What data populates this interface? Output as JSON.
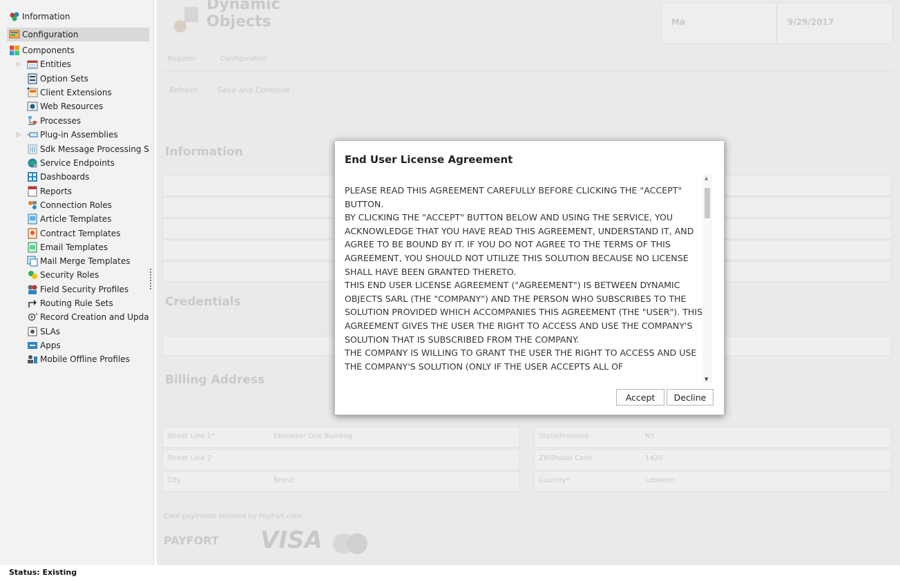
{
  "sidebar": {
    "top": [
      {
        "label": "Information",
        "icon": "information-icon"
      },
      {
        "label": "Configuration",
        "icon": "configuration-icon"
      },
      {
        "label": "Components",
        "icon": "components-icon"
      }
    ],
    "components": [
      {
        "label": "Entities",
        "icon": "entities-icon",
        "expandable": true
      },
      {
        "label": "Option Sets",
        "icon": "option-sets-icon"
      },
      {
        "label": "Client Extensions",
        "icon": "client-extensions-icon"
      },
      {
        "label": "Web Resources",
        "icon": "web-resources-icon"
      },
      {
        "label": "Processes",
        "icon": "processes-icon"
      },
      {
        "label": "Plug-in Assemblies",
        "icon": "plugin-assemblies-icon",
        "expandable": true
      },
      {
        "label": "Sdk Message Processing St...",
        "icon": "sdk-message-icon"
      },
      {
        "label": "Service Endpoints",
        "icon": "service-endpoints-icon"
      },
      {
        "label": "Dashboards",
        "icon": "dashboards-icon"
      },
      {
        "label": "Reports",
        "icon": "reports-icon"
      },
      {
        "label": "Connection Roles",
        "icon": "connection-roles-icon"
      },
      {
        "label": "Article Templates",
        "icon": "article-templates-icon"
      },
      {
        "label": "Contract Templates",
        "icon": "contract-templates-icon"
      },
      {
        "label": "Email Templates",
        "icon": "email-templates-icon"
      },
      {
        "label": "Mail Merge Templates",
        "icon": "mail-merge-icon"
      },
      {
        "label": "Security Roles",
        "icon": "security-roles-icon"
      },
      {
        "label": "Field Security Profiles",
        "icon": "field-security-icon"
      },
      {
        "label": "Routing Rule Sets",
        "icon": "routing-rule-icon"
      },
      {
        "label": "Record Creation and Upda...",
        "icon": "record-creation-icon"
      },
      {
        "label": "SLAs",
        "icon": "slas-icon"
      },
      {
        "label": "Apps",
        "icon": "apps-icon"
      },
      {
        "label": "Mobile Offline Profiles",
        "icon": "mobile-offline-icon"
      }
    ],
    "selected": "Configuration"
  },
  "background": {
    "title_line1": "Dynamic",
    "title_line2": "Objects",
    "header_value1": "Ma",
    "header_value2": "9/29/2017",
    "tabs": [
      "Register",
      "Configuration"
    ],
    "toolbar": [
      "Refresh",
      "Save and Continue"
    ],
    "section_information": "Information",
    "section_credentials": "Credentials",
    "section_billing": "Billing Address",
    "billing_fields": {
      "street1_label": "Street Line 1*",
      "street1_value": "Ebenezer One Building",
      "street2_label": "Street Line 2",
      "city_label": "City",
      "city_value": "Beirut",
      "state_label": "State/Province",
      "state_value": "NY",
      "zip_label": "ZIP/Postal Code",
      "zip_value": "1420",
      "country_label": "Country*",
      "country_value": "Lebanon"
    },
    "payment_note": "Card payments secured by PayFort.com",
    "payment_logos": [
      "PAYFORT",
      "VISA"
    ]
  },
  "dialog": {
    "title": "End User License Agreement",
    "eula_text": "PLEASE READ THIS AGREEMENT CAREFULLY BEFORE CLICKING THE \"ACCEPT\" BUTTON.\nBY CLICKING THE \"ACCEPT\" BUTTON BELOW AND USING THE SERVICE, YOU ACKNOWLEDGE THAT YOU HAVE READ THIS AGREEMENT, UNDERSTAND IT, AND AGREE TO BE BOUND BY IT. IF YOU DO NOT AGREE TO THE TERMS OF THIS AGREEMENT, YOU SHOULD NOT UTILIZE THIS SOLUTION BECAUSE NO LICENSE SHALL HAVE BEEN GRANTED THERETO.\nTHIS END USER LICENSE AGREEMENT (\"AGREEMENT\") IS BETWEEN DYNAMIC OBJECTS SARL (THE \"COMPANY\") AND THE PERSON WHO SUBSCRIBES TO THE SOLUTION PROVIDED WHICH ACCOMPANIES THIS AGREEMENT (THE \"USER\"). THIS AGREEMENT GIVES THE USER THE RIGHT TO ACCESS AND USE THE COMPANY'S SOLUTION THAT IS SUBSCRIBED FROM THE COMPANY.\nTHE COMPANY IS WILLING TO GRANT THE USER THE RIGHT TO ACCESS AND USE THE COMPANY'S SOLUTION (ONLY IF THE USER ACCEPTS ALL OF",
    "accept_label": "Accept",
    "decline_label": "Decline"
  },
  "status": "Status: Existing"
}
